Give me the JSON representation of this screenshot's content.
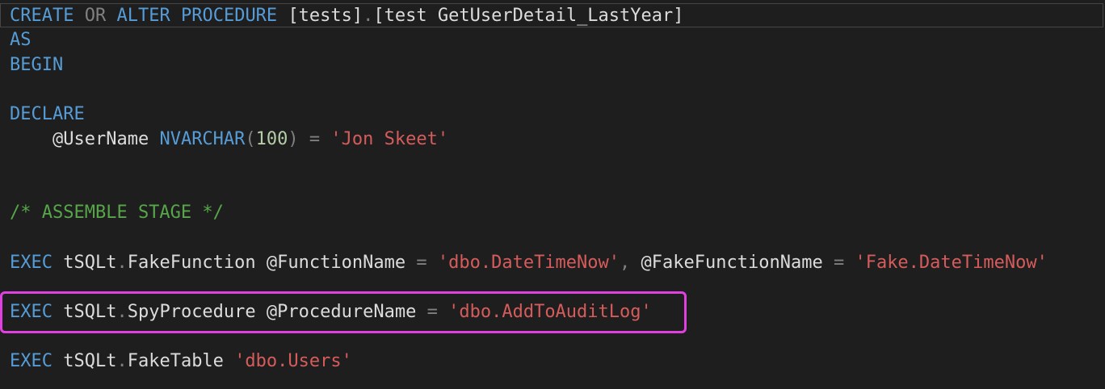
{
  "lines": {
    "l1": {
      "create": "CREATE",
      "or": "OR",
      "alter": "ALTER",
      "procedure": "PROCEDURE",
      "schema": "[tests]",
      "dot": ".",
      "name": "[test GetUserDetail_LastYear]"
    },
    "l2": {
      "as": "AS"
    },
    "l3": {
      "begin": "BEGIN"
    },
    "l5": {
      "declare": "DECLARE"
    },
    "l6": {
      "var": "@UserName",
      "type": "NVARCHAR",
      "paren_open": "(",
      "size": "100",
      "paren_close": ")",
      "eq": "=",
      "value": "'Jon Skeet'"
    },
    "l9": {
      "comment": "/* ASSEMBLE STAGE */"
    },
    "l11": {
      "exec": "EXEC",
      "obj": "tSQLt",
      "dot": ".",
      "proc": "FakeFunction",
      "p1": "@FunctionName",
      "eq1": "=",
      "v1": "'dbo.DateTimeNow'",
      "comma": ",",
      "p2": "@FakeFunctionName",
      "eq2": "=",
      "v2": "'Fake.DateTimeNow'"
    },
    "l13": {
      "exec": "EXEC",
      "obj": "tSQLt",
      "dot": ".",
      "proc": "SpyProcedure",
      "p1": "@ProcedureName",
      "eq1": "=",
      "v1": "'dbo.AddToAuditLog'"
    },
    "l15": {
      "exec": "EXEC",
      "obj": "tSQLt",
      "dot": ".",
      "proc": "FakeTable",
      "v1": "'dbo.Users'"
    }
  },
  "colors": {
    "background": "#1e1e1e",
    "keyword": "#569cd6",
    "string": "#d65c5c",
    "comment": "#57a64a",
    "number": "#b5cea8",
    "highlight": "#e040e0"
  }
}
